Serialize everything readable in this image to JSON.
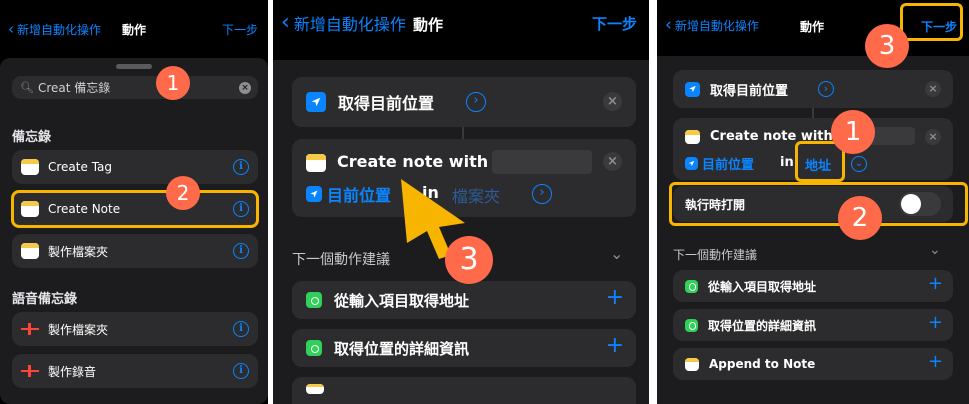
{
  "panel1": {
    "nav": {
      "back_label": "新增自動化操作",
      "title": "動作",
      "next_label": "下一步"
    },
    "search": {
      "value": "Creat 備忘錄"
    },
    "section_notes": "備忘錄",
    "notes_items": [
      {
        "label": "Create Tag",
        "icon": "notes-app-icon"
      },
      {
        "label": "Create Note",
        "icon": "notes-app-icon"
      },
      {
        "label": "製作檔案夾",
        "icon": "notes-app-icon"
      }
    ],
    "section_voice": "語音備忘錄",
    "voice_items": [
      {
        "label": "製作檔案夾",
        "icon": "voice-memos-icon"
      },
      {
        "label": "製作錄音",
        "icon": "voice-memos-icon"
      }
    ],
    "badges": [
      "1",
      "2"
    ]
  },
  "panel2": {
    "nav": {
      "back_label": "新增自動化操作",
      "title": "動作",
      "next_label": "下一步"
    },
    "action1_label": "取得目前位置",
    "action2": {
      "prefix": "Create note with",
      "token": "目前位置",
      "in": "in",
      "folder": "檔案夾"
    },
    "suggest_header": "下一個動作建議",
    "suggestions": [
      "從輸入項目取得地址",
      "取得位置的詳細資訊"
    ],
    "badge": "3"
  },
  "panel3": {
    "nav": {
      "back_label": "新增自動化操作",
      "title": "動作",
      "next_label": "下一步"
    },
    "action1_label": "取得目前位置",
    "action2": {
      "prefix": "Create note with",
      "token": "目前位置",
      "in": "in",
      "address": "地址"
    },
    "toggle_label": "執行時打開",
    "toggle_on": false,
    "suggest_header": "下一個動作建議",
    "suggestions": [
      "從輸入項目取得地址",
      "取得位置的詳細資訊",
      "Append to Note"
    ],
    "badges": [
      "1",
      "2",
      "3"
    ]
  },
  "colors": {
    "accent": "#0a84ff",
    "highlight": "#f7b500",
    "badge": "#ff6b4a",
    "background": "#000000",
    "card": "#2c2c2e"
  }
}
